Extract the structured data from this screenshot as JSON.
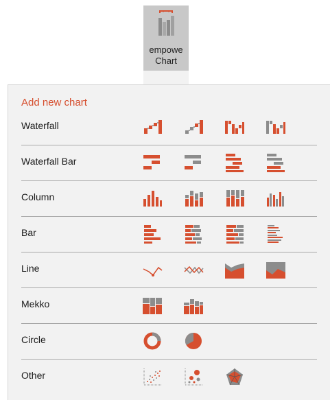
{
  "ribbon": {
    "button_label_line1": "empowe",
    "button_label_line2": "Chart",
    "icon": "empower-chart-icon"
  },
  "panel": {
    "title": "Add new chart",
    "rows": [
      {
        "label": "Waterfall",
        "icons": [
          "waterfall-icon",
          "waterfall-gray-icon",
          "waterfall-grouped-icon",
          "waterfall-grouped-gray-icon"
        ]
      },
      {
        "label": "Waterfall Bar",
        "icons": [
          "waterfall-bar-icon",
          "waterfall-bar-gray-icon",
          "waterfall-bar-stacked-icon",
          "waterfall-bar-stacked-gray-icon"
        ]
      },
      {
        "label": "Column",
        "icons": [
          "column-clustered-icon",
          "column-stacked-icon",
          "column-100-icon",
          "column-grouped-icon"
        ]
      },
      {
        "label": "Bar",
        "icons": [
          "bar-clustered-icon",
          "bar-stacked-icon",
          "bar-100-icon",
          "bar-grouped-icon"
        ]
      },
      {
        "label": "Line",
        "icons": [
          "line-icon",
          "line-multi-icon",
          "area-stacked-icon",
          "area-icon"
        ]
      },
      {
        "label": "Mekko",
        "icons": [
          "mekko-icon",
          "mekko-bar-icon"
        ]
      },
      {
        "label": "Circle",
        "icons": [
          "doughnut-icon",
          "pie-icon"
        ]
      },
      {
        "label": "Other",
        "icons": [
          "scatter-icon",
          "bubble-icon",
          "radar-icon"
        ]
      }
    ]
  },
  "colors": {
    "accent": "#d64f2f",
    "gray": "#8c8c8c",
    "panel_bg": "#f2f2f2",
    "ribbon_bg": "#c8c8c8"
  }
}
